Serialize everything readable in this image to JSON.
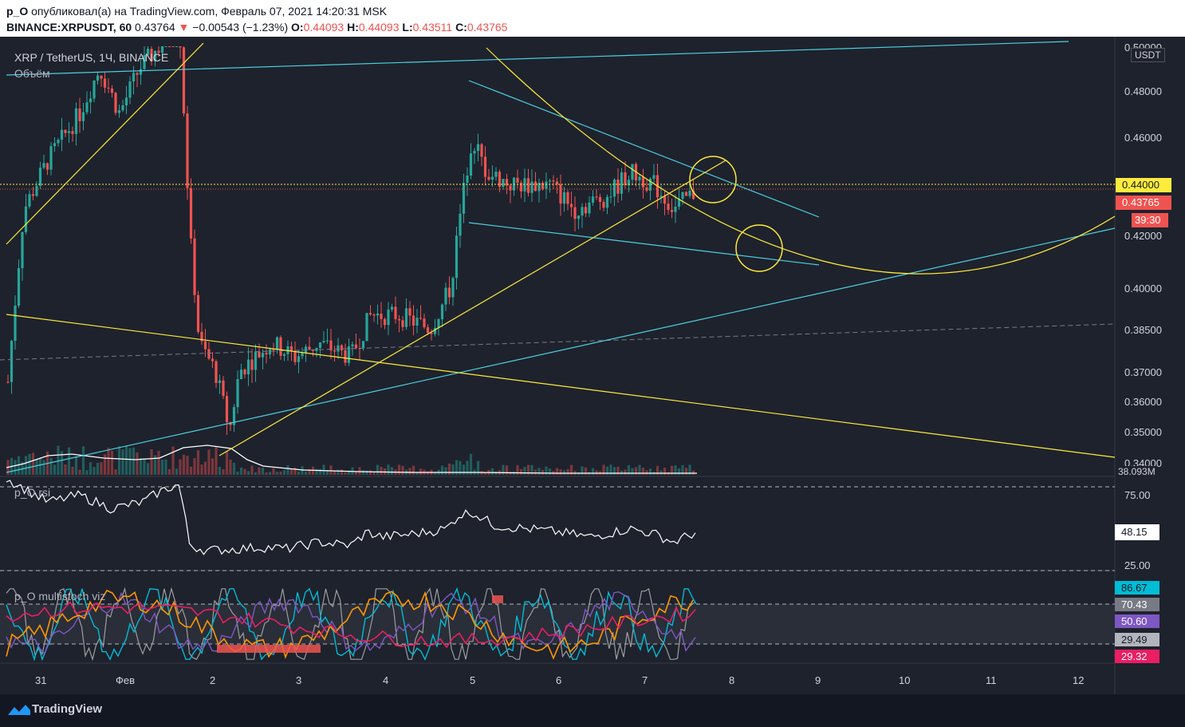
{
  "header": {
    "user": "p_O",
    "published_text": "опубликовал(а) на TradingView.com, Февраль 07, 2021 14:20:31 MSK",
    "symbol": "BINANCE:XRPUSDT, 60",
    "last": "0.43764",
    "arrow": "▼",
    "change": "−0.00543 (−1.23%)",
    "o_label": "O:",
    "o": "0.44093",
    "h_label": "H:",
    "h": "0.44093",
    "l_label": "L:",
    "l": "0.43511",
    "c_label": "C:",
    "c": "0.43765"
  },
  "legend": {
    "main": "XRP / TetherUS, 1Ч, BINANCE",
    "volume": "Объём",
    "rsi": "p_O rsi",
    "stoch": "p_O multistoch viz",
    "currency": "USDT"
  },
  "price_axis": {
    "ticks": [
      "0.50000",
      "0.48000",
      "0.46000",
      "0.42000",
      "0.40000",
      "0.38500",
      "0.37000",
      "0.36000",
      "0.35000",
      "0.34000"
    ],
    "tag_yellow": "0.44000",
    "tag_red": "0.43765",
    "tag_timer": "39:30",
    "volume_tag": "38.093M"
  },
  "rsi_axis": {
    "ticks": [
      "75.00",
      "25.00"
    ],
    "value": "48.15"
  },
  "stoch_axis": {
    "values": [
      "86.67",
      "70.43",
      "50.60",
      "29.49",
      "29.32"
    ]
  },
  "time_axis": {
    "ticks": [
      "31",
      "Фев",
      "2",
      "3",
      "4",
      "5",
      "6",
      "7",
      "8",
      "9",
      "10",
      "11",
      "12"
    ]
  },
  "footer": {
    "brand": "TradingView"
  },
  "colors": {
    "bg": "#1e222d",
    "up": "#26a69a",
    "down": "#ef5350",
    "trend_yellow": "#ffeb3b",
    "trend_cyan": "#4dd0e1",
    "stoch_cyan": "#00bcd4",
    "stoch_gray": "#9e9e9e",
    "stoch_purple": "#7e57c2",
    "stoch_orange": "#ff9800",
    "stoch_pink": "#e91e63"
  },
  "chart_data": {
    "type": "candlestick",
    "title": "XRP / TetherUS, 1Ч, BINANCE",
    "x_label": "",
    "y_label": "",
    "x_ticks": [
      "31",
      "Фев",
      "2",
      "3",
      "4",
      "5",
      "6",
      "7",
      "8",
      "9",
      "10",
      "11",
      "12"
    ],
    "ylim": [
      0.34,
      0.5
    ],
    "y_scale": "log",
    "horizontal_levels": [
      0.44,
      0.43765
    ],
    "last_candle": {
      "open": 0.44093,
      "high": 0.44093,
      "low": 0.43511,
      "close": 0.43765
    },
    "price_path_approx": [
      {
        "x": "31",
        "price": 0.36
      },
      {
        "x": "31",
        "price": 0.47
      },
      {
        "x": "Фев",
        "price": 0.49
      },
      {
        "x": "Фев",
        "price": 0.5
      },
      {
        "x": "2",
        "price": 0.37
      },
      {
        "x": "2",
        "price": 0.35
      },
      {
        "x": "3",
        "price": 0.375
      },
      {
        "x": "4",
        "price": 0.39
      },
      {
        "x": "5",
        "price": 0.46
      },
      {
        "x": "6",
        "price": 0.435
      },
      {
        "x": "7",
        "price": 0.45
      },
      {
        "x": "7",
        "price": 0.4376
      }
    ],
    "rsi": {
      "levels": [
        75,
        25
      ],
      "last": 48.15
    },
    "multistoch_last": [
      86.67,
      70.43,
      50.6,
      29.49,
      29.32
    ]
  }
}
